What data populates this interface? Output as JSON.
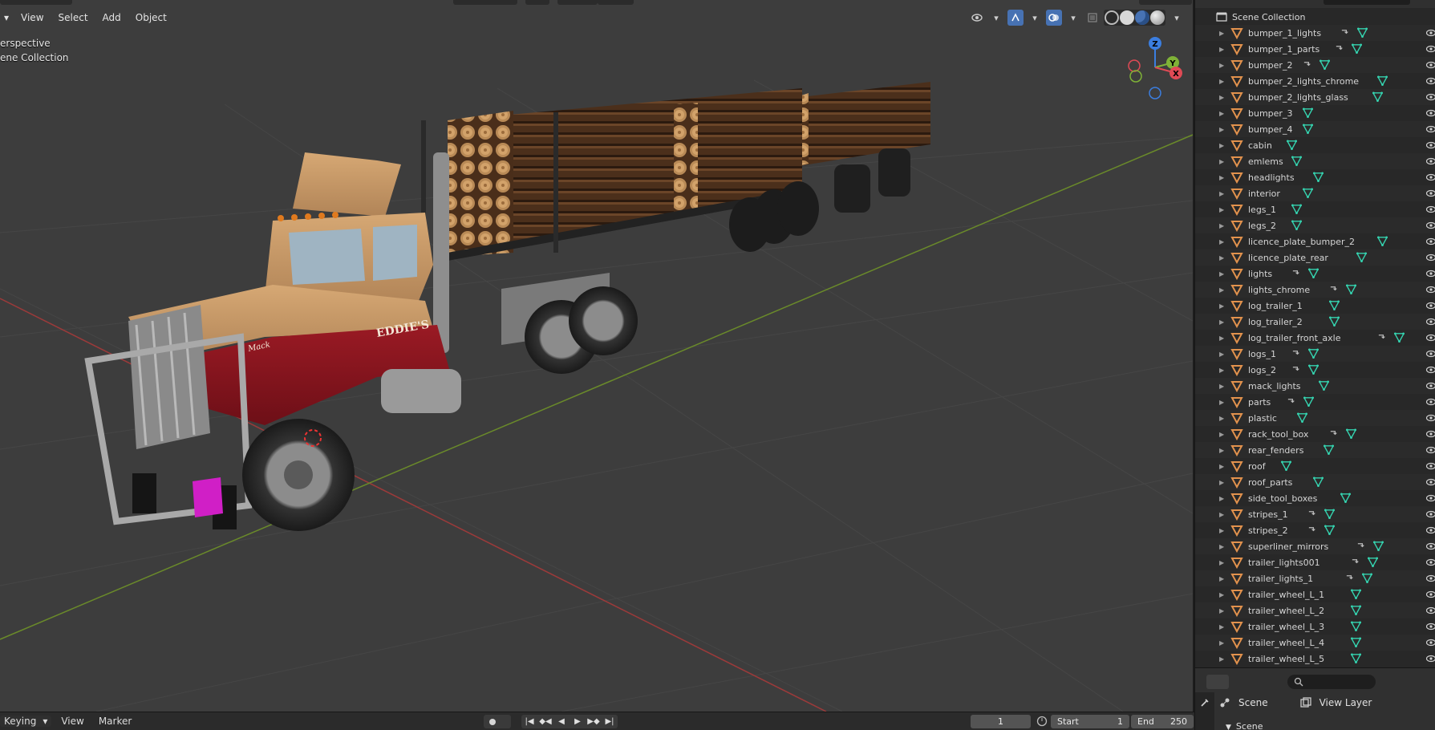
{
  "viewport": {
    "menu": {
      "mode_arrow": "▾",
      "items": [
        "View",
        "Select",
        "Add",
        "Object"
      ]
    },
    "overlay": {
      "view_name": "erspective",
      "collection": "ene Collection"
    },
    "gizmo": {
      "z_label": "Z",
      "y_label": "Y",
      "x_label": "X"
    }
  },
  "outliner": {
    "scene_collection": "Scene Collection",
    "objects": [
      {
        "name": "bumper_1_lights",
        "link": true
      },
      {
        "name": "bumper_1_parts",
        "link": true
      },
      {
        "name": "bumper_2",
        "link": true
      },
      {
        "name": "bumper_2_lights_chrome",
        "link": false
      },
      {
        "name": "bumper_2_lights_glass",
        "link": false
      },
      {
        "name": "bumper_3",
        "link": false
      },
      {
        "name": "bumper_4",
        "link": false
      },
      {
        "name": "cabin",
        "link": false
      },
      {
        "name": "emlems",
        "link": false
      },
      {
        "name": "headlights",
        "link": false
      },
      {
        "name": "interior",
        "link": false
      },
      {
        "name": "legs_1",
        "link": false
      },
      {
        "name": "legs_2",
        "link": false
      },
      {
        "name": "licence_plate_bumper_2",
        "link": false
      },
      {
        "name": "licence_plate_rear",
        "link": false
      },
      {
        "name": "lights",
        "link": true
      },
      {
        "name": "lights_chrome",
        "link": true
      },
      {
        "name": "log_trailer_1",
        "link": false
      },
      {
        "name": "log_trailer_2",
        "link": false
      },
      {
        "name": "log_trailer_front_axle",
        "link": true
      },
      {
        "name": "logs_1",
        "link": true
      },
      {
        "name": "logs_2",
        "link": true
      },
      {
        "name": "mack_lights",
        "link": false
      },
      {
        "name": "parts",
        "link": true
      },
      {
        "name": "plastic",
        "link": false
      },
      {
        "name": "rack_tool_box",
        "link": true
      },
      {
        "name": "rear_fenders",
        "link": false
      },
      {
        "name": "roof",
        "link": false
      },
      {
        "name": "roof_parts",
        "link": false
      },
      {
        "name": "side_tool_boxes",
        "link": false
      },
      {
        "name": "stripes_1",
        "link": true
      },
      {
        "name": "stripes_2",
        "link": true
      },
      {
        "name": "superliner_mirrors",
        "link": true
      },
      {
        "name": "trailer_lights001",
        "link": true
      },
      {
        "name": "trailer_lights_1",
        "link": true
      },
      {
        "name": "trailer_wheel_L_1",
        "link": false
      },
      {
        "name": "trailer_wheel_L_2",
        "link": false
      },
      {
        "name": "trailer_wheel_L_3",
        "link": false
      },
      {
        "name": "trailer_wheel_L_4",
        "link": false
      },
      {
        "name": "trailer_wheel_L_5",
        "link": false
      }
    ]
  },
  "properties": {
    "scene_tab": "Scene",
    "view_layer_tab": "View Layer",
    "section": "Scene"
  },
  "timeline": {
    "keying": "Keying",
    "view": "View",
    "marker": "Marker",
    "current_frame": "1",
    "start_label": "Start",
    "start_value": "1",
    "end_label": "End",
    "end_value": "250"
  },
  "truck": {
    "brand_text": "EDDIE'S",
    "hood_text": "Mack"
  },
  "colors": {
    "viewport_bg": "#3d3d3d",
    "grid_x_axis": "#9b3a3a",
    "grid_y_axis": "#6a8a2a",
    "cab_tan": "#c49565",
    "cab_red": "#8a1620",
    "object_icon": "#e2924d",
    "mesh_icon": "#35d4b0",
    "accent_blue": "#4772b3"
  }
}
